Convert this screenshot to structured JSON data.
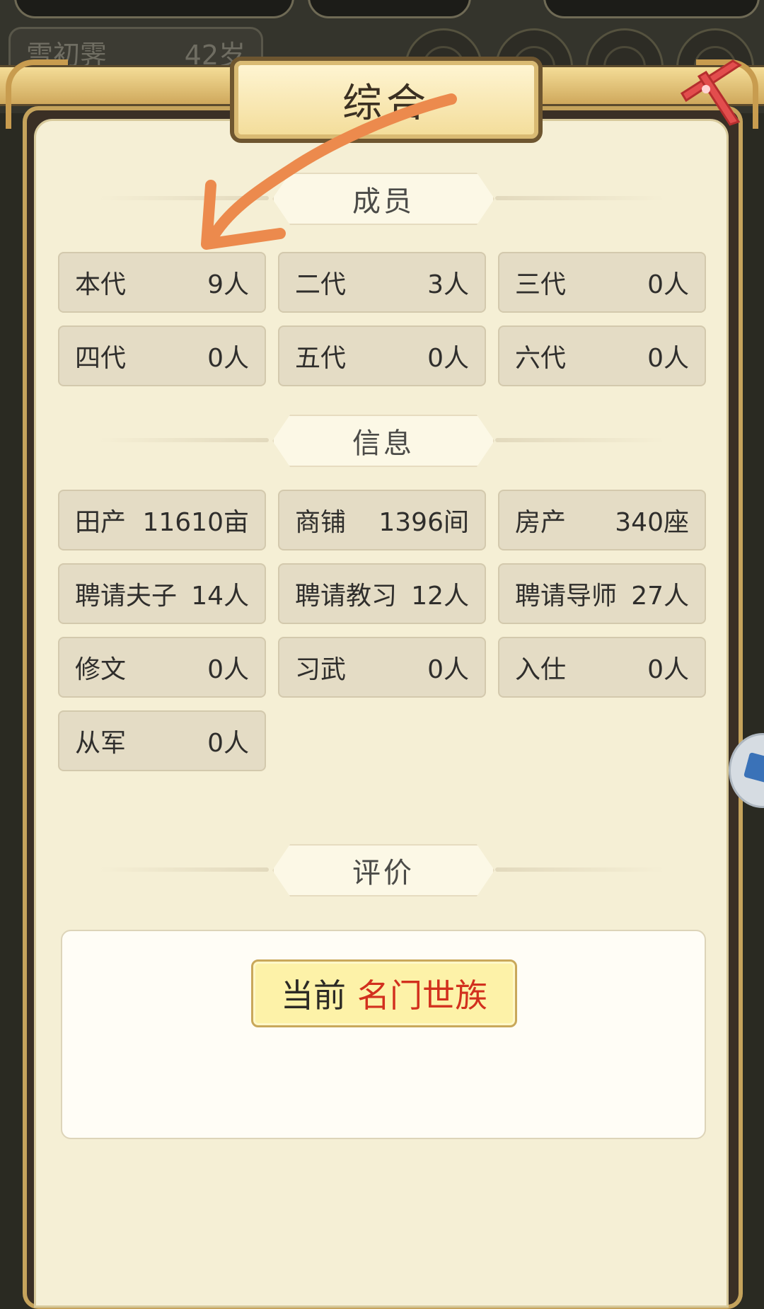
{
  "background": {
    "character_name": "雪初霁",
    "character_age": "42岁"
  },
  "dialog": {
    "title": "综合",
    "close_icon": "close-x-icon",
    "sections": {
      "members": {
        "title": "成员",
        "items": [
          {
            "label": "本代",
            "value": "9人"
          },
          {
            "label": "二代",
            "value": "3人"
          },
          {
            "label": "三代",
            "value": "0人"
          },
          {
            "label": "四代",
            "value": "0人"
          },
          {
            "label": "五代",
            "value": "0人"
          },
          {
            "label": "六代",
            "value": "0人"
          }
        ]
      },
      "info": {
        "title": "信息",
        "items": [
          {
            "label": "田产",
            "value": "11610亩"
          },
          {
            "label": "商铺",
            "value": "1396间"
          },
          {
            "label": "房产",
            "value": "340座"
          },
          {
            "label": "聘请夫子",
            "value": "14人"
          },
          {
            "label": "聘请教习",
            "value": "12人"
          },
          {
            "label": "聘请导师",
            "value": "27人"
          },
          {
            "label": "修文",
            "value": "0人"
          },
          {
            "label": "习武",
            "value": "0人"
          },
          {
            "label": "入仕",
            "value": "0人"
          },
          {
            "label": "从军",
            "value": "0人"
          }
        ]
      },
      "evaluation": {
        "title": "评价",
        "prefix": "当前",
        "rank": "名门世族"
      }
    }
  },
  "colors": {
    "panel_bg": "#f5efd5",
    "stat_bg": "#e4dcc5",
    "rank_red": "#d2301e",
    "annotation_orange": "#ec8a4d"
  }
}
